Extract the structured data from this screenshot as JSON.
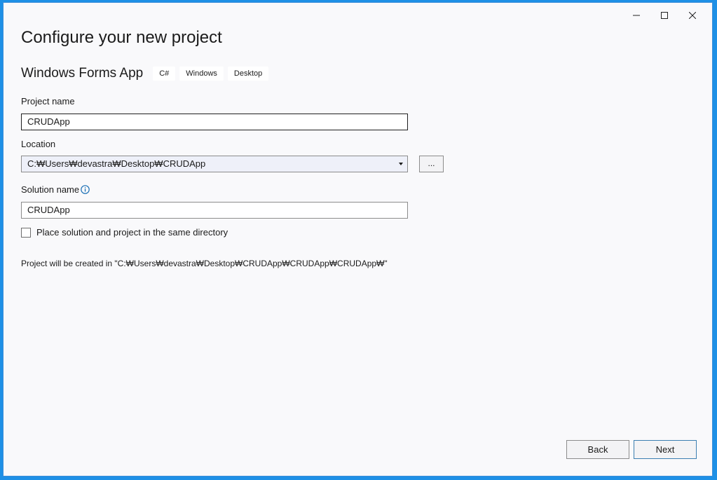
{
  "dialog": {
    "title": "Configure your new project"
  },
  "template": {
    "name": "Windows Forms App",
    "tags": [
      "C#",
      "Windows",
      "Desktop"
    ]
  },
  "project_name": {
    "label": "Project name",
    "value": "CRUDApp"
  },
  "location": {
    "label": "Location",
    "value": "C:₩Users₩devastra₩Desktop₩CRUDApp",
    "browse_label": "..."
  },
  "solution_name": {
    "label": "Solution name",
    "value": "CRUDApp",
    "info_icon": "info-icon"
  },
  "same_directory": {
    "label": "Place solution and project in the same directory",
    "checked": false
  },
  "path_info": "Project will be created in \"C:₩Users₩devastra₩Desktop₩CRUDApp₩CRUDApp₩CRUDApp₩\"",
  "buttons": {
    "back": "Back",
    "next": "Next"
  },
  "colors": {
    "accent": "#1e90e6",
    "info": "#1a6fb5"
  }
}
